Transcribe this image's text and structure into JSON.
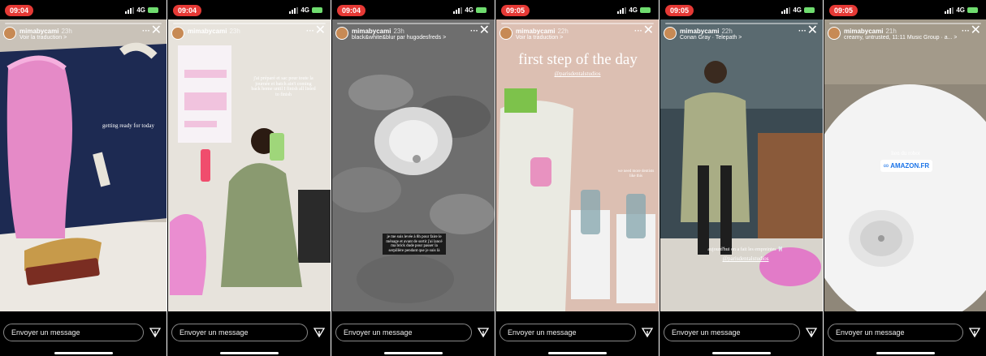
{
  "stories": [
    {
      "time": "09:04",
      "network": "4G",
      "username": "mimabycami",
      "age": "23h",
      "subline": "Voir la traduction >",
      "caption": "getting ready for today",
      "message_placeholder": "Envoyer un message"
    },
    {
      "time": "09:04",
      "network": "4G",
      "username": "mimabycami",
      "age": "23h",
      "subline": "",
      "caption": "j'ai préparé et sac pour toute la journée et batch ain't coming back home until I finish all listed to finish",
      "message_placeholder": "Envoyer un message"
    },
    {
      "time": "09:04",
      "network": "4G",
      "username": "mimabycami",
      "age": "23h",
      "subline": "black&white&blur par hugodesfreds >",
      "caption": "je me suis levée à 8h pour faire le ménage et avant de sortir j'ai lancé ma brick dude pour passer la serpillère pendant que je suis là",
      "message_placeholder": "Envoyer un message"
    },
    {
      "time": "09:05",
      "network": "4G",
      "username": "mimabycami",
      "age": "22h",
      "subline": "Voir la traduction >",
      "caption": "first step of the day",
      "mention": "@parisdentalstudios",
      "side_note": "we need more dentists like this",
      "message_placeholder": "Envoyer un message"
    },
    {
      "time": "09:05",
      "network": "4G",
      "username": "mimabycami",
      "age": "22h",
      "subline": "Conan Gray · Telepath >",
      "caption": "aujourd'hui on a fait les empreintes 🦷",
      "mention": "@parisdentalstudios",
      "message_placeholder": "Envoyer un message"
    },
    {
      "time": "09:05",
      "network": "4G",
      "username": "mimabycami",
      "age": "21h",
      "subline": "creamy, untrusted, 11:11 Music Group · a... >",
      "caption": "lien du robot",
      "link_text": "AMAZON.FR",
      "message_placeholder": "Envoyer un message"
    }
  ],
  "colors": {
    "time_pill": "#e53935",
    "battery": "#6fdc6f"
  },
  "icons": {
    "close": "close-icon",
    "more": "more-icon",
    "send": "send-icon",
    "link": "link-icon"
  }
}
